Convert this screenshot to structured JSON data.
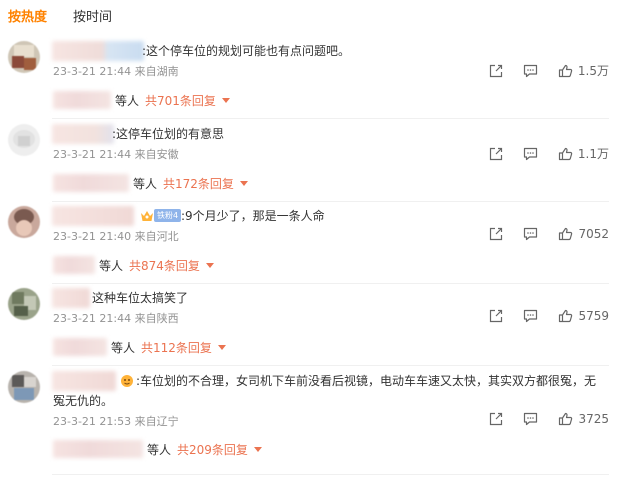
{
  "sort_tabs": [
    {
      "label": "按热度",
      "active": true
    },
    {
      "label": "按时间",
      "active": false
    }
  ],
  "comments": [
    {
      "text": ":这个停车位的规划可能也有点问题吧。",
      "time": "23-3-21 21:44",
      "location": "来自湖南",
      "likes": "1.5万",
      "reply_suffix": "等人",
      "reply_total": "共701条回复"
    },
    {
      "text": ":这停车位划的有意思",
      "time": "23-3-21 21:44",
      "location": "来自安徽",
      "likes": "1.1万",
      "reply_suffix": "等人",
      "reply_total": "共172条回复"
    },
    {
      "badge": "铁粉4",
      "text": ":9个月少了，那是一条人命",
      "time": "23-3-21 21:40",
      "location": "来自河北",
      "likes": "7052",
      "reply_suffix": "等人",
      "reply_total": "共874条回复"
    },
    {
      "text": "这种车位太搞笑了",
      "time": "23-3-21 21:44",
      "location": "来自陕西",
      "likes": "5759",
      "reply_suffix": "等人",
      "reply_total": "共112条回复"
    },
    {
      "text_line1": ":车位划的不合理，女司机下车前没看后视镜，电动车车速又太快，其实双方都很冤，无",
      "text_line2": "冤无仇的。",
      "time": "23-3-21 21:53",
      "location": "来自辽宁",
      "likes": "3725",
      "reply_suffix": "等人",
      "reply_total": "共209条回复"
    }
  ],
  "colors": {
    "accent": "#ff8200",
    "reply_link": "#eb7350",
    "meta": "#939393"
  }
}
